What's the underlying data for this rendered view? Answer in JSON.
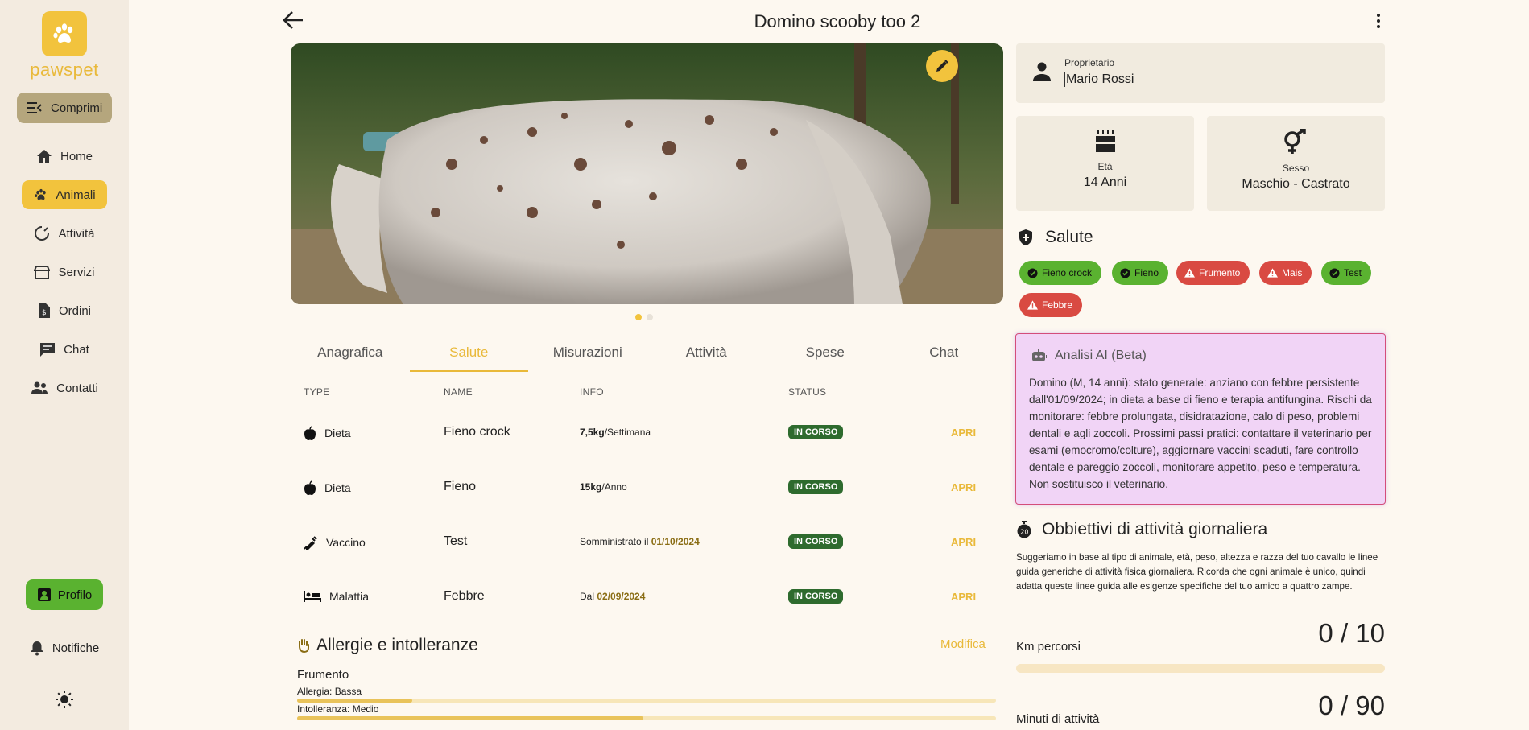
{
  "app": {
    "logo_text": "pawspet",
    "title": "Domino scooby too 2"
  },
  "sidebar": {
    "collapse_label": "Comprimi",
    "items": [
      {
        "label": "Home",
        "icon": "home-icon"
      },
      {
        "label": "Animali",
        "icon": "paw-icon",
        "active": true
      },
      {
        "label": "Attività",
        "icon": "activity-icon"
      },
      {
        "label": "Servizi",
        "icon": "store-icon"
      },
      {
        "label": "Ordini",
        "icon": "receipt-icon"
      },
      {
        "label": "Chat",
        "icon": "chat-icon"
      },
      {
        "label": "Contatti",
        "icon": "contacts-icon"
      }
    ],
    "profile_label": "Profilo",
    "notifications_label": "Notifiche"
  },
  "tabs": [
    "Anagrafica",
    "Salute",
    "Misurazioni",
    "Attività",
    "Spese",
    "Chat"
  ],
  "table": {
    "headers": {
      "type": "TYPE",
      "name": "NAME",
      "info": "INFO",
      "status": "STATUS"
    },
    "rows": [
      {
        "type": "Dieta",
        "name": "Fieno crock",
        "info_bold": "7,5kg",
        "info_rest": "/Settimana",
        "info_prefix": "",
        "info_date": "",
        "status": "IN CORSO",
        "action": "APRI"
      },
      {
        "type": "Dieta",
        "name": "Fieno",
        "info_bold": "15kg",
        "info_rest": "/Anno",
        "info_prefix": "",
        "info_date": "",
        "status": "IN CORSO",
        "action": "APRI"
      },
      {
        "type": "Vaccino",
        "name": "Test",
        "info_bold": "",
        "info_rest": "",
        "info_prefix": "Somministrato il ",
        "info_date": "01/10/2024",
        "status": "IN CORSO",
        "action": "APRI"
      },
      {
        "type": "Malattia",
        "name": "Febbre",
        "info_bold": "",
        "info_rest": "",
        "info_prefix": "Dal ",
        "info_date": "02/09/2024",
        "status": "IN CORSO",
        "action": "APRI"
      }
    ]
  },
  "allergies": {
    "title": "Allergie e intolleranze",
    "edit_label": "Modifica",
    "item": {
      "name": "Frumento",
      "allergy_label": "Allergia: Bassa",
      "intolerance_label": "Intolleranza: Medio",
      "allergy_level": 0.165,
      "intolerance_level": 0.495
    }
  },
  "owner": {
    "label": "Proprietario",
    "value": "Mario Rossi"
  },
  "age": {
    "label": "Età",
    "value": "14 Anni"
  },
  "sex": {
    "label": "Sesso",
    "value": "Maschio - Castrato"
  },
  "health": {
    "title": "Salute",
    "chips": [
      {
        "label": "Fieno crock",
        "kind": "ok"
      },
      {
        "label": "Fieno",
        "kind": "ok"
      },
      {
        "label": "Frumento",
        "kind": "warn"
      },
      {
        "label": "Mais",
        "kind": "warn"
      },
      {
        "label": "Test",
        "kind": "ok"
      },
      {
        "label": "Febbre",
        "kind": "warn"
      }
    ]
  },
  "ai": {
    "title": "Analisi AI (Beta)",
    "text": "Domino (M, 14 anni): stato generale: anziano con febbre persistente dall'01/09/2024; in dieta a base di fieno e terapia antifungina. Rischi da monitorare: febbre prolungata, disidratazione, calo di peso, problemi dentali e agli zoccoli. Prossimi passi pratici: contattare il veterinario per esami (emocromo/colture), aggiornare vaccini scaduti, fare controllo dentale e pareggio zoccoli, monitorare appetito, peso e temperatura. Non sostituisco il veterinario."
  },
  "goals": {
    "title": "Obbiettivi di attività giornaliera",
    "description": "Suggeriamo in base al tipo di animale, età, peso, altezza e razza del tuo cavallo le linee guida generiche di attività fisica giornaliera. Ricorda che ogni animale è unico, quindi adatta queste linee guida alle esigenze specifiche del tuo amico a quattro zampe.",
    "km": {
      "label": "Km percorsi",
      "value": "0 / 10"
    },
    "minutes": {
      "label": "Minuti di attività",
      "value": "0 / 90"
    }
  },
  "colors": {
    "accent": "#f2c33d",
    "success": "#5ab230",
    "danger": "#d94a42",
    "status": "#2e6b2e"
  }
}
